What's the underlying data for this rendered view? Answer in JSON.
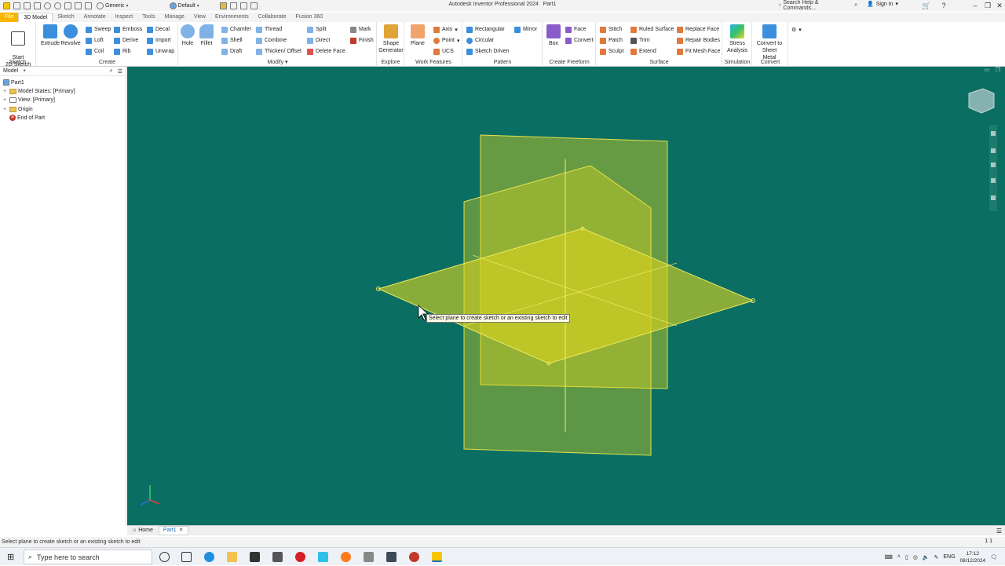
{
  "app": {
    "title": "Autodesk Inventor Professional 2024",
    "document": "Part1",
    "appearance_combo": "Generic",
    "material_combo": "Default",
    "search_placeholder": "Search Help & Commands...",
    "sign_in": "Sign In"
  },
  "tabs": [
    "File",
    "3D Model",
    "Sketch",
    "Annotate",
    "Inspect",
    "Tools",
    "Manage",
    "View",
    "Environments",
    "Collaborate",
    "Fusion 360"
  ],
  "active_tab": "3D Model",
  "ribbon": {
    "sketch": {
      "label": "Sketch",
      "start_sketch": "Start\n2D Sketch"
    },
    "create": {
      "label": "Create",
      "extrude": "Extrude",
      "revolve": "Revolve",
      "sweep": "Sweep",
      "loft": "Loft",
      "coil": "Coil",
      "emboss": "Emboss",
      "derive": "Derive",
      "rib": "Rib",
      "decal": "Decal",
      "import": "Import",
      "unwrap": "Unwrap"
    },
    "modify": {
      "label": "Modify",
      "hole": "Hole",
      "fillet": "Fillet",
      "chamfer": "Chamfer",
      "shell": "Shell",
      "draft": "Draft",
      "thread": "Thread",
      "combine": "Combine",
      "thicken": "Thicken/ Offset",
      "split": "Split",
      "direct": "Direct",
      "delete_face": "Delete Face",
      "mark": "Mark",
      "finish": "Finish"
    },
    "explore": {
      "label": "Explore",
      "shape_generator": "Shape\nGenerator"
    },
    "work_features": {
      "label": "Work Features",
      "plane": "Plane",
      "axis": "Axis",
      "point": "Point",
      "ucs": "UCS"
    },
    "pattern": {
      "label": "Pattern",
      "rectangular": "Rectangular",
      "circular": "Circular",
      "sketch_driven": "Sketch Driven",
      "mirror": "Mirror"
    },
    "freeform": {
      "label": "Create Freeform",
      "box": "Box",
      "face": "Face",
      "convert": "Convert"
    },
    "surface": {
      "label": "Surface",
      "stitch": "Stitch",
      "patch": "Patch",
      "sculpt": "Sculpt",
      "ruled_surface": "Ruled Surface",
      "trim": "Trim",
      "extend": "Extend",
      "replace_face": "Replace Face",
      "repair_bodies": "Repair Bodies",
      "fit_mesh_face": "Fit Mesh Face"
    },
    "simulation": {
      "label": "Simulation",
      "stress_analysis": "Stress\nAnalysis"
    },
    "convert": {
      "label": "Convert",
      "convert_sheet_metal": "Convert to\nSheet Metal"
    }
  },
  "browser": {
    "tab": "Model",
    "root": "Part1",
    "items": [
      "Model States: [Primary]",
      "View: [Primary]",
      "Origin",
      "End of Part"
    ]
  },
  "viewport": {
    "tooltip": "Select plane to create sketch or an existing sketch to edit",
    "background": "#0b6e62",
    "plane_color": "#d8d21e"
  },
  "doc_tabs": {
    "home": "Home",
    "part": "Part1"
  },
  "status": {
    "message": "Select plane to create sketch or an existing sketch to edit",
    "counts": "1   1"
  },
  "taskbar": {
    "search": "Type here to search",
    "lang": "ENG",
    "time": "17:12",
    "date": "08/12/2024"
  }
}
